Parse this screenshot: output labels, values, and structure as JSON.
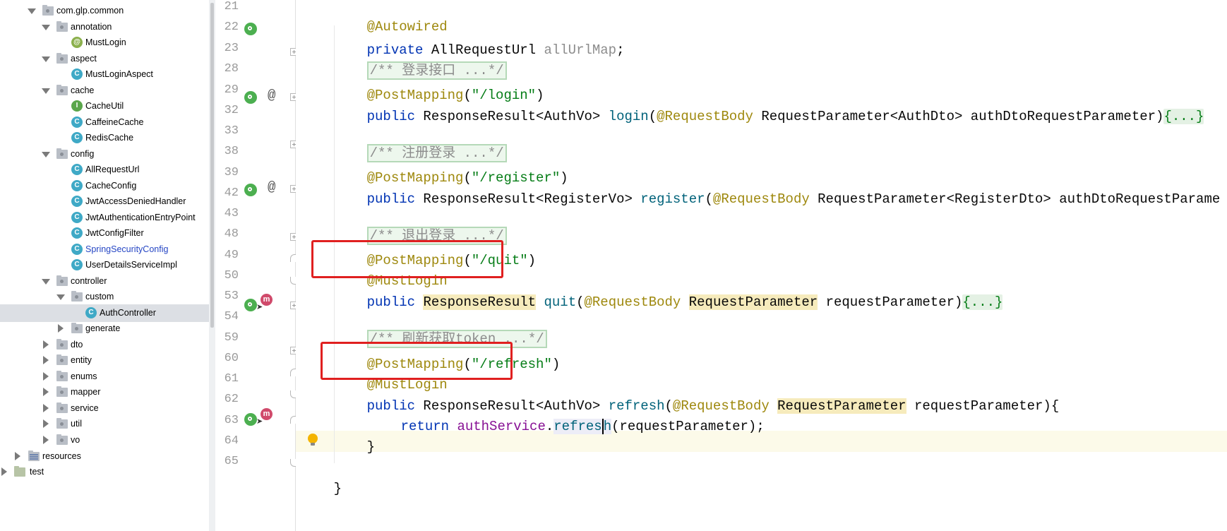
{
  "project_tree": {
    "items": [
      {
        "label": "com.glp.common",
        "type": "package",
        "expanded": true
      },
      {
        "label": "annotation",
        "type": "package",
        "expanded": true
      },
      {
        "label": "MustLogin",
        "type": "annotation"
      },
      {
        "label": "aspect",
        "type": "package",
        "expanded": true
      },
      {
        "label": "MustLoginAspect",
        "type": "class"
      },
      {
        "label": "cache",
        "type": "package",
        "expanded": true
      },
      {
        "label": "CacheUtil",
        "type": "interface"
      },
      {
        "label": "CaffeineCache",
        "type": "class"
      },
      {
        "label": "RedisCache",
        "type": "class"
      },
      {
        "label": "config",
        "type": "package",
        "expanded": true
      },
      {
        "label": "AllRequestUrl",
        "type": "class"
      },
      {
        "label": "CacheConfig",
        "type": "class"
      },
      {
        "label": "JwtAccessDeniedHandler",
        "type": "class"
      },
      {
        "label": "JwtAuthenticationEntryPoint",
        "type": "class"
      },
      {
        "label": "JwtConfigFilter",
        "type": "class"
      },
      {
        "label": "SpringSecurityConfig",
        "type": "class",
        "modified": true
      },
      {
        "label": "UserDetailsServiceImpl",
        "type": "class"
      },
      {
        "label": "controller",
        "type": "package",
        "expanded": true
      },
      {
        "label": "custom",
        "type": "package",
        "expanded": true
      },
      {
        "label": "AuthController",
        "type": "class",
        "selected": true
      },
      {
        "label": "generate",
        "type": "package",
        "expanded": false
      },
      {
        "label": "dto",
        "type": "package",
        "expanded": false
      },
      {
        "label": "entity",
        "type": "package",
        "expanded": false
      },
      {
        "label": "enums",
        "type": "package",
        "expanded": false
      },
      {
        "label": "mapper",
        "type": "package",
        "expanded": false
      },
      {
        "label": "service",
        "type": "package",
        "expanded": false
      },
      {
        "label": "util",
        "type": "package",
        "expanded": false
      },
      {
        "label": "vo",
        "type": "package",
        "expanded": false
      },
      {
        "label": "resources",
        "type": "resources",
        "expanded": false
      },
      {
        "label": "test",
        "type": "test-folder",
        "expanded": false
      }
    ]
  },
  "editor": {
    "line_numbers": [
      "21",
      "22",
      "23",
      "28",
      "29",
      "32",
      "33",
      "38",
      "39",
      "42",
      "43",
      "48",
      "49",
      "50",
      "53",
      "54",
      "59",
      "60",
      "61",
      "62",
      "63",
      "64",
      "65"
    ],
    "code": {
      "l21": {
        "ann": "@Autowired"
      },
      "l22": {
        "kw": "private",
        "type": " AllRequestUrl ",
        "field": "allUrlMap",
        "end": ";"
      },
      "l23": {
        "comment": "/** 登录接口 ...*/"
      },
      "l28": {
        "ann": "@PostMapping",
        "open": "(",
        "str": "\"/login\"",
        "close": ")"
      },
      "l29": {
        "kw": "public",
        "type": " ResponseResult<AuthVo> ",
        "method": "login",
        "open": "(",
        "ann": "@RequestBody",
        "rest": " RequestParameter<AuthDto> authDtoRequestParameter)",
        "fold": "{...}"
      },
      "l33": {
        "comment": "/** 注册登录 ...*/"
      },
      "l38": {
        "ann": "@PostMapping",
        "open": "(",
        "str": "\"/register\"",
        "close": ")"
      },
      "l39": {
        "kw": "public",
        "type": " ResponseResult<RegisterVo> ",
        "method": "register",
        "open": "(",
        "ann": "@RequestBody",
        "rest": " RequestParameter<RegisterDto> authDtoRequestParame"
      },
      "l43": {
        "comment": "/** 退出登录 ...*/"
      },
      "l48": {
        "ann": "@PostMapping",
        "open": "(",
        "str": "\"/quit\"",
        "close": ")"
      },
      "l49": {
        "ann": "@MustLogin"
      },
      "l50": {
        "kw": "public",
        "space": " ",
        "type_hl": "ResponseResult",
        "space2": " ",
        "method": "quit",
        "open": "(",
        "ann": "@RequestBody",
        "space3": " ",
        "param_hl": "RequestParameter",
        "rest": " requestParameter)",
        "fold": "{...}"
      },
      "l54": {
        "comment": "/** 刷新获取token ...*/"
      },
      "l59": {
        "ann": "@PostMapping",
        "open": "(",
        "str": "\"/refresh\"",
        "close": ")"
      },
      "l60": {
        "ann": "@MustLogin"
      },
      "l61": {
        "kw": "public",
        "type": " ResponseResult<AuthVo> ",
        "method": "refresh",
        "open": "(",
        "ann": "@RequestBody",
        "space": " ",
        "param_hl": "RequestParameter",
        "rest": " requestParameter){"
      },
      "l62": {
        "kw": "return",
        "space": " ",
        "field": "authService",
        "dot": ".",
        "method_a": "refres",
        "method_b": "h",
        "rest": "(requestParameter);"
      },
      "l63": {
        "text": "}"
      },
      "l65": {
        "text": "}"
      }
    }
  },
  "colors": {
    "keyword": "#0033b3",
    "annotation": "#9e880d",
    "string": "#067d17",
    "field": "#871094",
    "highlight_box": "#e02020"
  }
}
